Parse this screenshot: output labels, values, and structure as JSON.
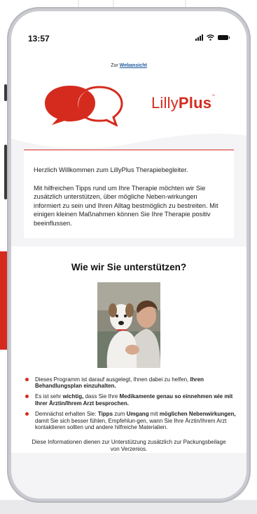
{
  "status_bar": {
    "time": "13:57"
  },
  "email": {
    "web_link_prefix": "Zur ",
    "web_link_label": "Webansicht",
    "logo": {
      "name_light": "Lilly",
      "name_bold": "Plus",
      "trademark": "™"
    },
    "intro_paragraphs": [
      "Herzlich Willkommen zum LillyPlus Therapiebegleiter.",
      "Mit hilfreichen Tipps rund um Ihre Therapie möchten wir Sie zusätzlich unterstützen, über mögliche Neben-wirkungen informiert zu sein und Ihren Alltag bestmöglich zu bestreiten. Mit einigen kleinen Maßnahmen können Sie Ihre Therapie positiv beeinflussen."
    ],
    "section_title": "Wie wir Sie unterstützen?",
    "bullets": [
      {
        "t1": "Dieses Programm ist darauf ausgelegt, Ihnen dabei zu helfen, ",
        "b1": "Ihren Behandlungsplan einzuhalten."
      },
      {
        "t1": "Es ist sehr ",
        "b1": "wichtig,",
        "t2": " dass Sie Ihre ",
        "b2": "Medikamente genau so einnehmen wie mit Ihrer Ärztin/Ihrem Arzt besprochen."
      },
      {
        "t1": "Demnächst erhalten Sie: ",
        "b1": "Tipps",
        "t2": " zum ",
        "b2": "Umgang",
        "t3": " mit ",
        "b3": "möglichen Nebenwirkungen,",
        "t4": " damit Sie sich besser fühlen, Empfehlun-gen, wann Sie Ihre Ärztin/Ihrem Arzt kontaktieren sollten und andere hilfreiche Materialien."
      }
    ],
    "footnote": "Diese Informationen dienen zur Unterstützung zusätzlich zur Packungsbeilage von Verzenios."
  },
  "colors": {
    "brand_red": "#d52b1e",
    "link_blue": "#1e5a9e",
    "page_grey": "#f4f4f6"
  },
  "icons": [
    "signal-icon",
    "wifi-icon",
    "battery-icon",
    "speech-bubbles-logo-icon"
  ]
}
